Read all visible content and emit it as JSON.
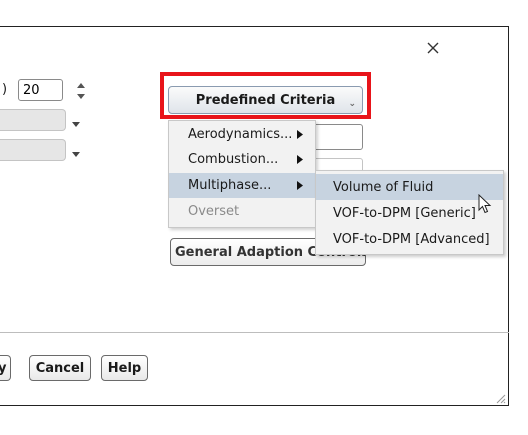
{
  "dialog": {
    "close_icon": "close-icon",
    "number_label": ")",
    "number_value": "20"
  },
  "predefined": {
    "button_label": "Predefined Criteria",
    "highlight_color": "#e8141a"
  },
  "menu": {
    "items": [
      {
        "label": "Aerodynamics...",
        "has_submenu": true
      },
      {
        "label": "Combustion...",
        "has_submenu": true
      },
      {
        "label": "Multiphase...",
        "has_submenu": true,
        "highlighted": true
      },
      {
        "label": "Overset",
        "disabled": true
      }
    ]
  },
  "submenu": {
    "items": [
      {
        "label": "Volume of Fluid",
        "highlighted": true
      },
      {
        "label": "VOF-to-DPM [Generic]"
      },
      {
        "label": "VOF-to-DPM [Advanced]"
      }
    ]
  },
  "general_adaption_controls": {
    "label": "General Adaption Controls"
  },
  "footer": {
    "partial_button_label": "y",
    "cancel_label": "Cancel",
    "help_label": "Help"
  }
}
